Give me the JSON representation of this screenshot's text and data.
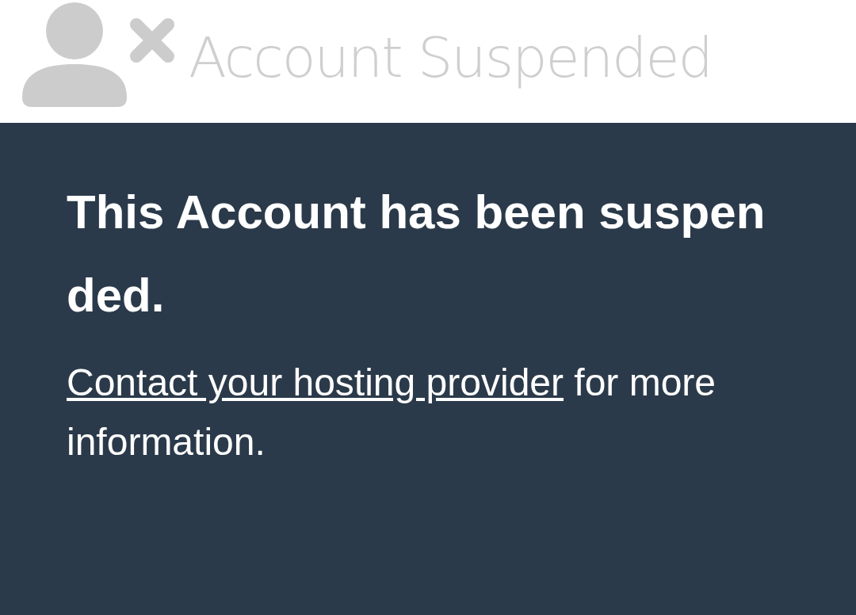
{
  "header": {
    "title": "Account Suspended"
  },
  "message": {
    "heading": "This Account has been suspended.",
    "link": "Contact your hosting provider",
    "text": "for more information."
  }
}
